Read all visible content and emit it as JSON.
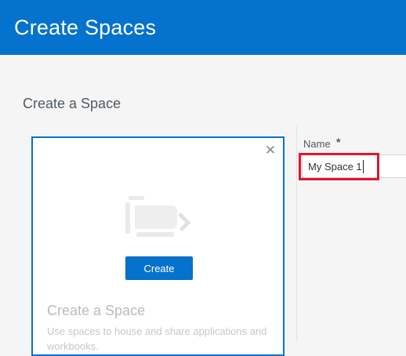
{
  "header": {
    "title": "Create Spaces"
  },
  "section": {
    "title": "Create a Space"
  },
  "card": {
    "close_icon": "close-icon",
    "illustration_icon": "space-illustration-icon",
    "create_label": "Create",
    "title": "Create a Space",
    "description": "Use spaces to house and share applications and workbooks."
  },
  "form": {
    "name_label": "Name",
    "required_marker": "*",
    "name_value": "My Space 1"
  },
  "colors": {
    "accent": "#0572ce",
    "highlight": "#e3162f"
  }
}
